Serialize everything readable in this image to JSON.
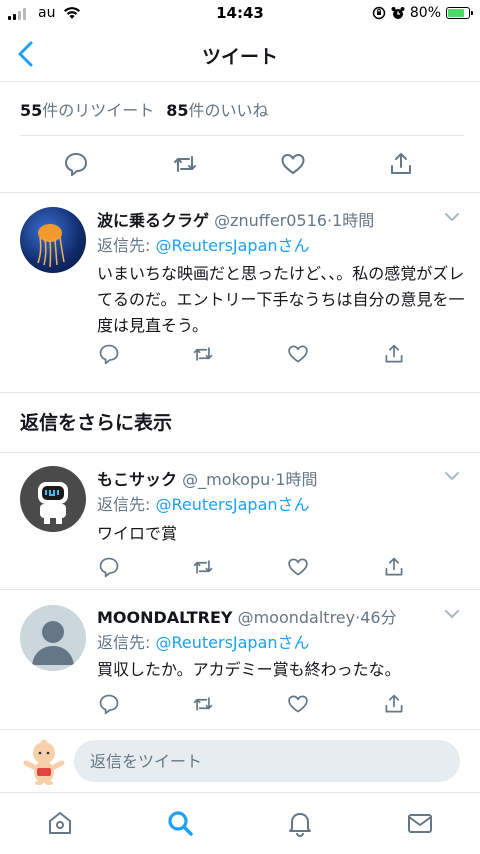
{
  "status_bar": {
    "carrier": "au",
    "time": "14:43",
    "battery_percent": "80%",
    "battery_level": 0.8
  },
  "header": {
    "title": "ツイート",
    "back_icon": "chevron-left-icon"
  },
  "counts": {
    "retweets_number": "55",
    "retweets_label": "件のリツイート",
    "likes_number": "85",
    "likes_label": "件のいいね"
  },
  "main_actions": [
    "reply-icon",
    "retweet-icon",
    "like-icon",
    "share-icon"
  ],
  "replies": [
    {
      "name": "波に乗るクラゲ",
      "handle": "@znuffer0516",
      "time": "1時間",
      "reply_to_prefix": "返信先: ",
      "reply_to_user": "@ReutersJapanさん",
      "text": "いまいちな映画だと思ったけど、、。私の感覚がズレてるのだ。エントリー下手なうちは自分の意見を一度は見直そう。"
    },
    {
      "name": "もこサック",
      "handle": "@_mokopu",
      "time": "1時間",
      "reply_to_prefix": "返信先: ",
      "reply_to_user": "@ReutersJapanさん",
      "text": "ワイロで賞"
    },
    {
      "name": "MOONDALTREY",
      "handle": "@moondaltrey",
      "time": "46分",
      "reply_to_prefix": "返信先: ",
      "reply_to_user": "@ReutersJapanさん",
      "text": "買収したか。アカデミー賞も終わったな。"
    }
  ],
  "show_more_replies": "返信をさらに表示",
  "composer": {
    "placeholder": "返信をツイート"
  },
  "tab_bar": [
    "home-icon",
    "search-icon",
    "notifications-icon",
    "messages-icon"
  ],
  "colors": {
    "accent": "#1da1f2",
    "secondary_text": "#657786",
    "divider": "#e1e8ed"
  }
}
